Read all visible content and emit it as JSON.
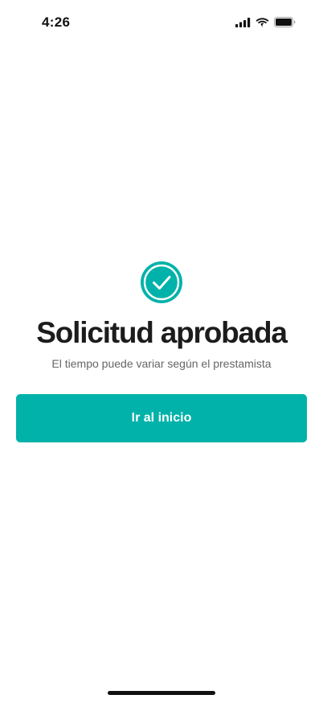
{
  "status_bar": {
    "time": "4:26",
    "icons": [
      "cellular-signal-icon",
      "wifi-icon",
      "battery-icon"
    ]
  },
  "success": {
    "icon": "check-circle-icon",
    "title": "Solicitud aprobada",
    "subtitle": "El tiempo puede variar según el prestamista"
  },
  "actions": {
    "primary_label": "Ir al inicio"
  },
  "colors": {
    "accent": "#00b2a9",
    "title": "#1c1c1c",
    "subtitle": "#666666",
    "background": "#ffffff"
  }
}
